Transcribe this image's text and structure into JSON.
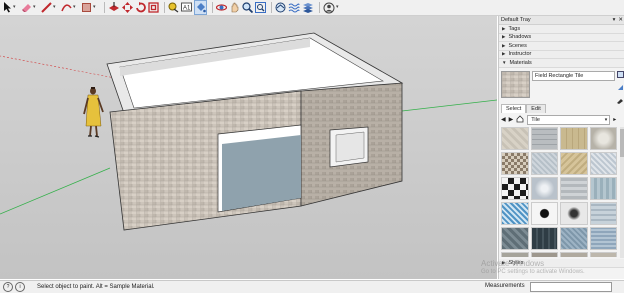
{
  "toolbar": {
    "tools": [
      {
        "name": "select-tool-icon"
      },
      {
        "name": "eraser-tool-icon"
      },
      {
        "name": "line-tool-icon"
      },
      {
        "name": "arc-tool-icon"
      },
      {
        "name": "rectangle-tool-icon"
      },
      {
        "name": "push-pull-tool-icon"
      },
      {
        "name": "move-tool-icon"
      },
      {
        "name": "rotate-tool-icon"
      },
      {
        "name": "offset-tool-icon"
      },
      {
        "name": "tape-measure-tool-icon"
      },
      {
        "name": "text-tool-icon"
      },
      {
        "name": "paint-bucket-tool-icon"
      },
      {
        "name": "orbit-tool-icon"
      },
      {
        "name": "pan-tool-icon"
      },
      {
        "name": "zoom-tool-icon"
      },
      {
        "name": "zoom-extents-icon"
      },
      {
        "name": "warehouse-icon"
      },
      {
        "name": "extension-icon"
      },
      {
        "name": "share-model-icon"
      },
      {
        "name": "account-icon"
      }
    ],
    "active_tool": "paint-bucket-tool-icon"
  },
  "tray": {
    "title": "Default Tray",
    "panels_top": [
      {
        "label": "Tags",
        "expanded": false
      },
      {
        "label": "Shadows",
        "expanded": false
      },
      {
        "label": "Scenes",
        "expanded": false
      },
      {
        "label": "Instructor",
        "expanded": false
      },
      {
        "label": "Materials",
        "expanded": true
      }
    ],
    "materials": {
      "current_name": "Field Rectangle Tile",
      "tabs": [
        "Select",
        "Edit"
      ],
      "selected_tab": "Select",
      "library": "Tile"
    },
    "panel_bottom": {
      "label": "Styles",
      "expanded": false
    }
  },
  "status": {
    "hint": "Select object to paint. Alt = Sample Material.",
    "measurements_label": "Measurements",
    "measurements_value": ""
  },
  "watermark": {
    "line1": "Activate Windows",
    "line2": "Go to PC settings to activate Windows."
  },
  "colors": {
    "wall_front": "#c9c1b7",
    "wall_side": "#b6aea4",
    "door_glass": "#8fa2ad",
    "window_glass": "#e6e6e6",
    "axis_green": "#34b04a",
    "axis_red": "#d23c3c",
    "axis_blue": "#3060d0"
  }
}
